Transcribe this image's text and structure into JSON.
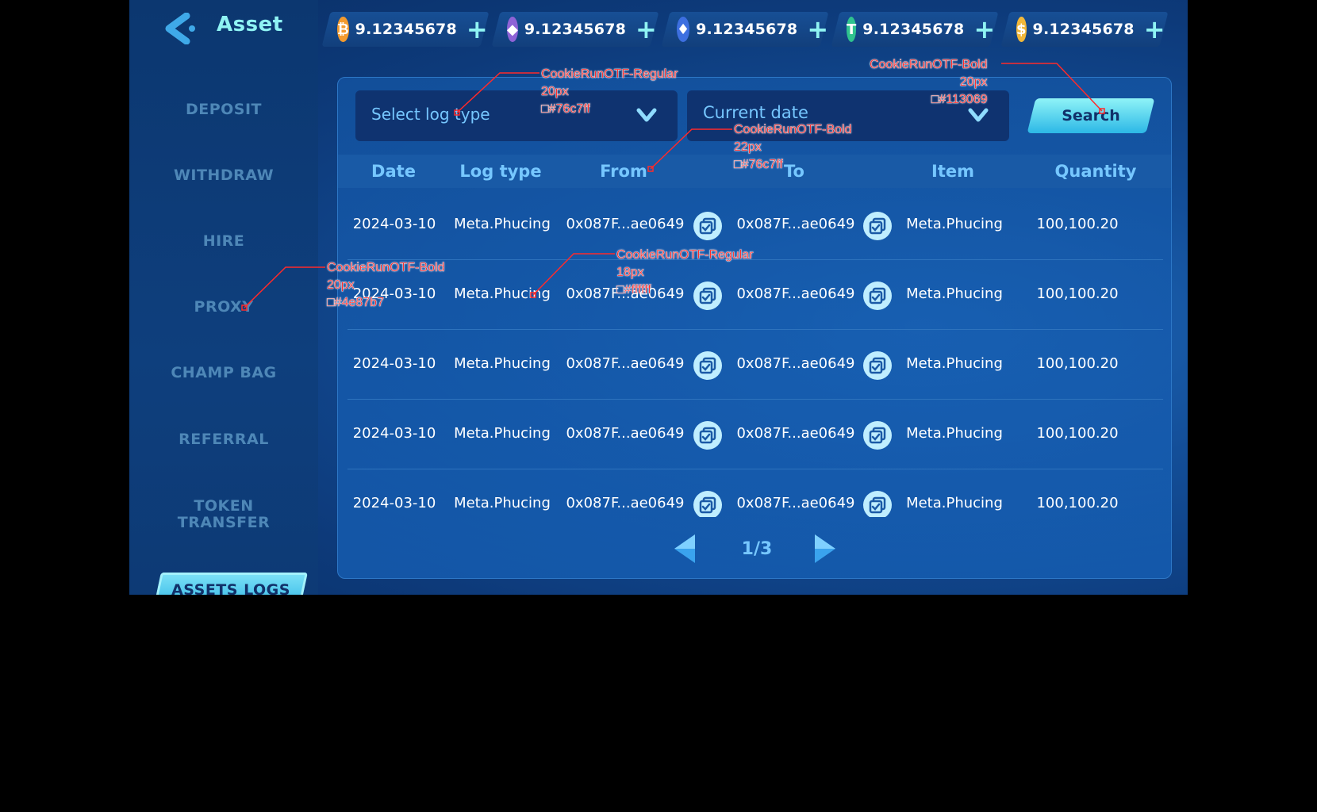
{
  "header": {
    "title": "Asset",
    "currencies": [
      {
        "icon": "bitcoin-icon",
        "symbol": "₿",
        "color": "#f29a2e",
        "amount": "9.12345678"
      },
      {
        "icon": "ethereum-icon",
        "symbol": "◆",
        "color": "#8e63d6",
        "amount": "9.12345678"
      },
      {
        "icon": "fire-token-icon",
        "symbol": "♦",
        "color": "#3d6fe0",
        "amount": "9.12345678"
      },
      {
        "icon": "tether-icon",
        "symbol": "T",
        "color": "#2fc28e",
        "amount": "9.12345678"
      },
      {
        "icon": "dollar-coin-icon",
        "symbol": "$",
        "color": "#f0b73a",
        "amount": "9.12345678"
      }
    ],
    "add_label": "+"
  },
  "sidebar": {
    "items": [
      {
        "label": "DEPOSIT"
      },
      {
        "label": "WITHDRAW"
      },
      {
        "label": "HIRE"
      },
      {
        "label": "PROXY"
      },
      {
        "label": "CHAMP BAG"
      },
      {
        "label": "REFERRAL"
      },
      {
        "label": "TOKEN TRANSFER"
      },
      {
        "label": "ASSETS LOGS",
        "active": true
      }
    ]
  },
  "filters": {
    "log_type_placeholder": "Select log type",
    "date_placeholder": "Current date",
    "search_label": "Search"
  },
  "table": {
    "columns": [
      "Date",
      "Log type",
      "From",
      "To",
      "Item",
      "Quantity"
    ],
    "rows": [
      {
        "date": "2024-03-10",
        "log_type": "Meta.Phucing",
        "from": "0x087F...ae0649",
        "to": "0x087F...ae0649",
        "item": "Meta.Phucing",
        "quantity": "100,100.20"
      },
      {
        "date": "2024-03-10",
        "log_type": "Meta.Phucing",
        "from": "0x087F...ae0649",
        "to": "0x087F...ae0649",
        "item": "Meta.Phucing",
        "quantity": "100,100.20"
      },
      {
        "date": "2024-03-10",
        "log_type": "Meta.Phucing",
        "from": "0x087F...ae0649",
        "to": "0x087F...ae0649",
        "item": "Meta.Phucing",
        "quantity": "100,100.20"
      },
      {
        "date": "2024-03-10",
        "log_type": "Meta.Phucing",
        "from": "0x087F...ae0649",
        "to": "0x087F...ae0649",
        "item": "Meta.Phucing",
        "quantity": "100,100.20"
      },
      {
        "date": "2024-03-10",
        "log_type": "Meta.Phucing",
        "from": "0x087F...ae0649",
        "to": "0x087F...ae0649",
        "item": "Meta.Phucing",
        "quantity": "100,100.20"
      }
    ]
  },
  "pagination": {
    "text": "1/3"
  },
  "annotations": [
    {
      "font": "CookieRunOTF-Regular",
      "size": "20px",
      "color": "#76c7ff"
    },
    {
      "font": "CookieRunOTF-Bold",
      "size": "20px",
      "color": "#113069"
    },
    {
      "font": "CookieRunOTF-Bold",
      "size": "22px",
      "color": "#76c7ff"
    },
    {
      "font": "CookieRunOTF-Regular",
      "size": "18px",
      "color": "#ffffff"
    },
    {
      "font": "CookieRunOTF-Bold",
      "size": "20px",
      "color": "#4e87b7"
    }
  ],
  "colors": {
    "accent": "#8ff3f3",
    "label_blue": "#76c7ff",
    "nav_inactive": "#4e87b7",
    "dark_text": "#113069"
  }
}
